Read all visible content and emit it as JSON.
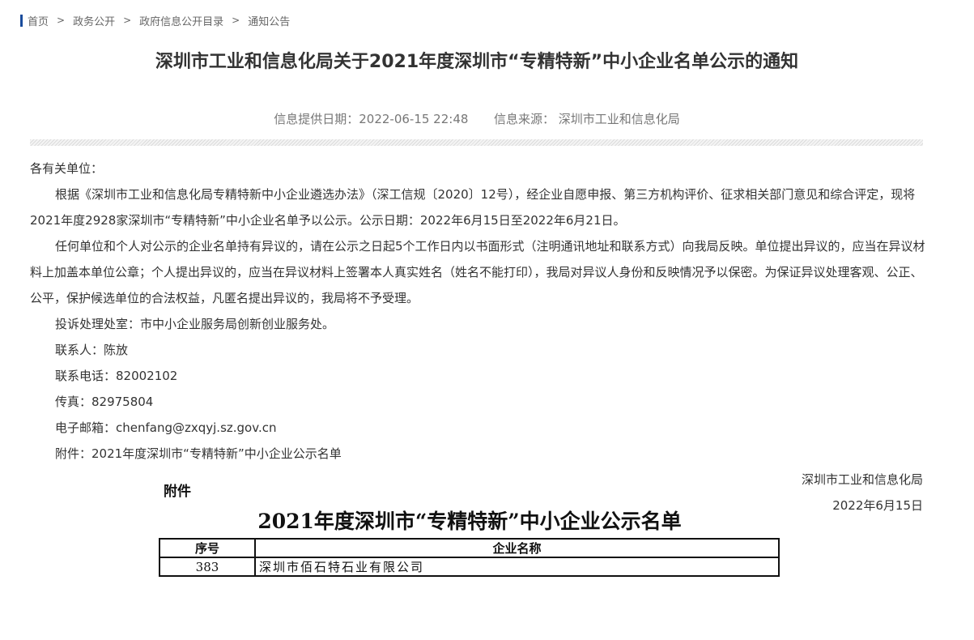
{
  "breadcrumb": {
    "items": [
      "首页",
      "政务公开",
      "政府信息公开目录",
      "通知公告"
    ],
    "separator": ">"
  },
  "article": {
    "title": "深圳市工业和信息化局关于2021年度深圳市“专精特新”中小企业名单公示的通知",
    "date_label": "信息提供日期：",
    "date_value": "2022-06-15 22:48",
    "source_label": "信息来源：",
    "source_value": "深圳市工业和信息化局",
    "salutation": "各有关单位：",
    "paragraphs": [
      "根据《深圳市工业和信息化局专精特新中小企业遴选办法》（深工信规〔2020〕12号），经企业自愿申报、第三方机构评价、征求相关部门意见和综合评定，现将2021年度2928家深圳市“专精特新”中小企业名单予以公示。公示日期：2022年6月15日至2022年6月21日。",
      "任何单位和个人对公示的企业名单持有异议的，请在公示之日起5个工作日内以书面形式（注明通讯地址和联系方式）向我局反映。单位提出异议的，应当在异议材料上加盖本单位公章；个人提出异议的，应当在异议材料上签署本人真实姓名（姓名不能打印），我局对异议人身份和反映情况予以保密。为保证异议处理客观、公正、公平，保护候选单位的合法权益，凡匿名提出异议的，我局将不予受理。"
    ],
    "contact_office": "投诉处理处室：市中小企业服务局创新创业服务处。",
    "contact_person": "联系人：陈放",
    "contact_phone": "联系电话：82002102",
    "fax": "传真：82975804",
    "email": "电子邮箱：chenfang@zxqyj.sz.gov.cn",
    "attachment": "附件：2021年度深圳市“专精特新”中小企业公示名单",
    "signature_org": "深圳市工业和信息化局",
    "signature_date": "2022年6月15日"
  },
  "attachment_image": {
    "label": "附件",
    "title": "2021年度深圳市“专精特新”中小企业公示名单",
    "columns": [
      "序号",
      "企业名称"
    ],
    "rows": [
      {
        "no": "383",
        "name": "深圳市佰石特石业有限公司"
      }
    ]
  },
  "colors": {
    "breadcrumb_bar": "#1a4c9c",
    "text": "#333333",
    "meta": "#777777"
  }
}
